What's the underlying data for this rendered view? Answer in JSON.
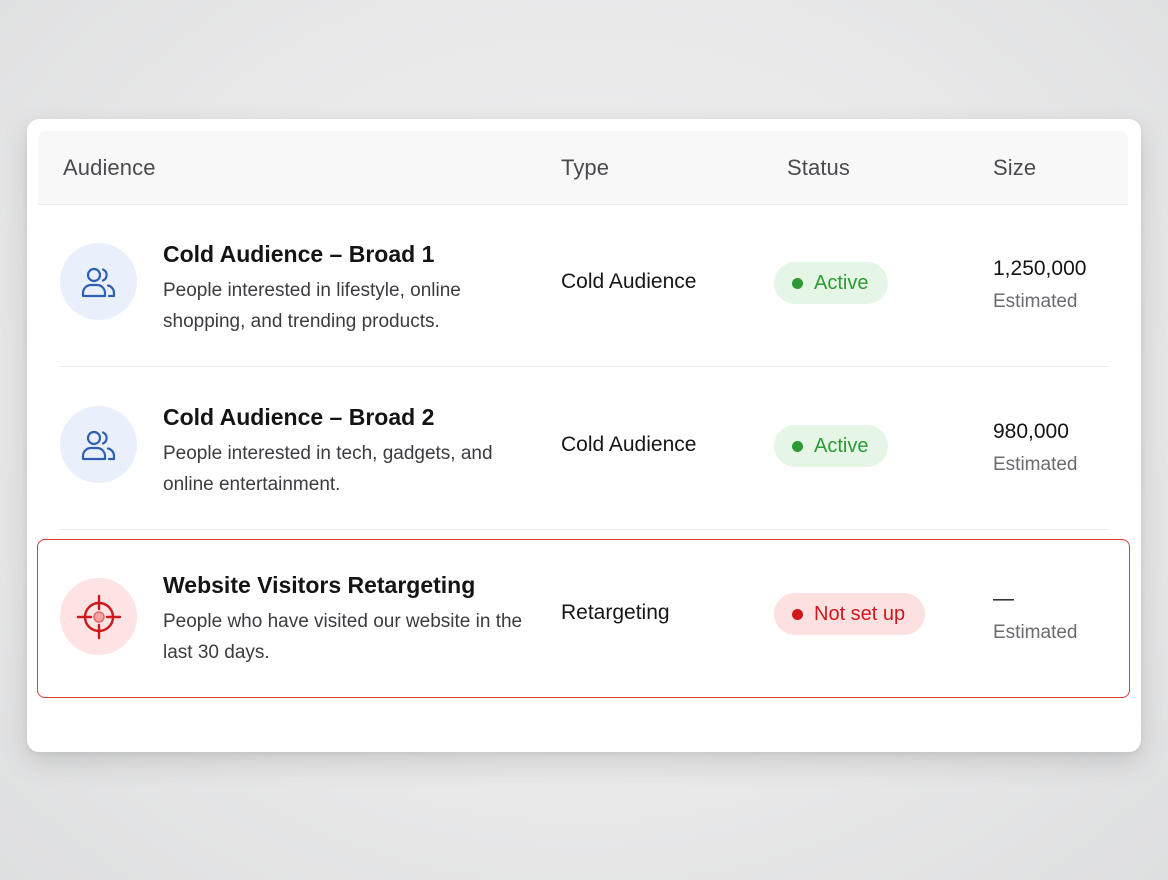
{
  "table": {
    "headers": {
      "audience": "Audience",
      "type": "Type",
      "status": "Status",
      "size": "Size"
    },
    "rows": [
      {
        "icon": "users-icon",
        "title": "Cold Audience – Broad 1",
        "description": "People interested in lifestyle, online shopping, and trending products.",
        "type": "Cold Audience",
        "status": "Active",
        "size": "1,250,000",
        "size_note": "Estimated"
      },
      {
        "icon": "users-icon",
        "title": "Cold Audience – Broad 2",
        "description": "People interested in tech, gadgets, and online entertainment.",
        "type": "Cold Audience",
        "status": "Active",
        "size": "980,000",
        "size_note": "Estimated"
      },
      {
        "icon": "target-icon",
        "title": "Website Visitors Retargeting",
        "description": "People who have visited our website in the last 30 days.",
        "type": "Retargeting",
        "status": "Not set up",
        "size": "—",
        "size_note": "Estimated",
        "highlighted": true
      }
    ]
  },
  "colors": {
    "active_text": "#2e9a35",
    "active_bg": "#e6f6e6",
    "not_set_text": "#d0181c",
    "not_set_bg": "#fde0e0",
    "highlight_border": "#e0383b",
    "users_icon": "#2f5fb3",
    "target_icon": "#d0181c"
  }
}
